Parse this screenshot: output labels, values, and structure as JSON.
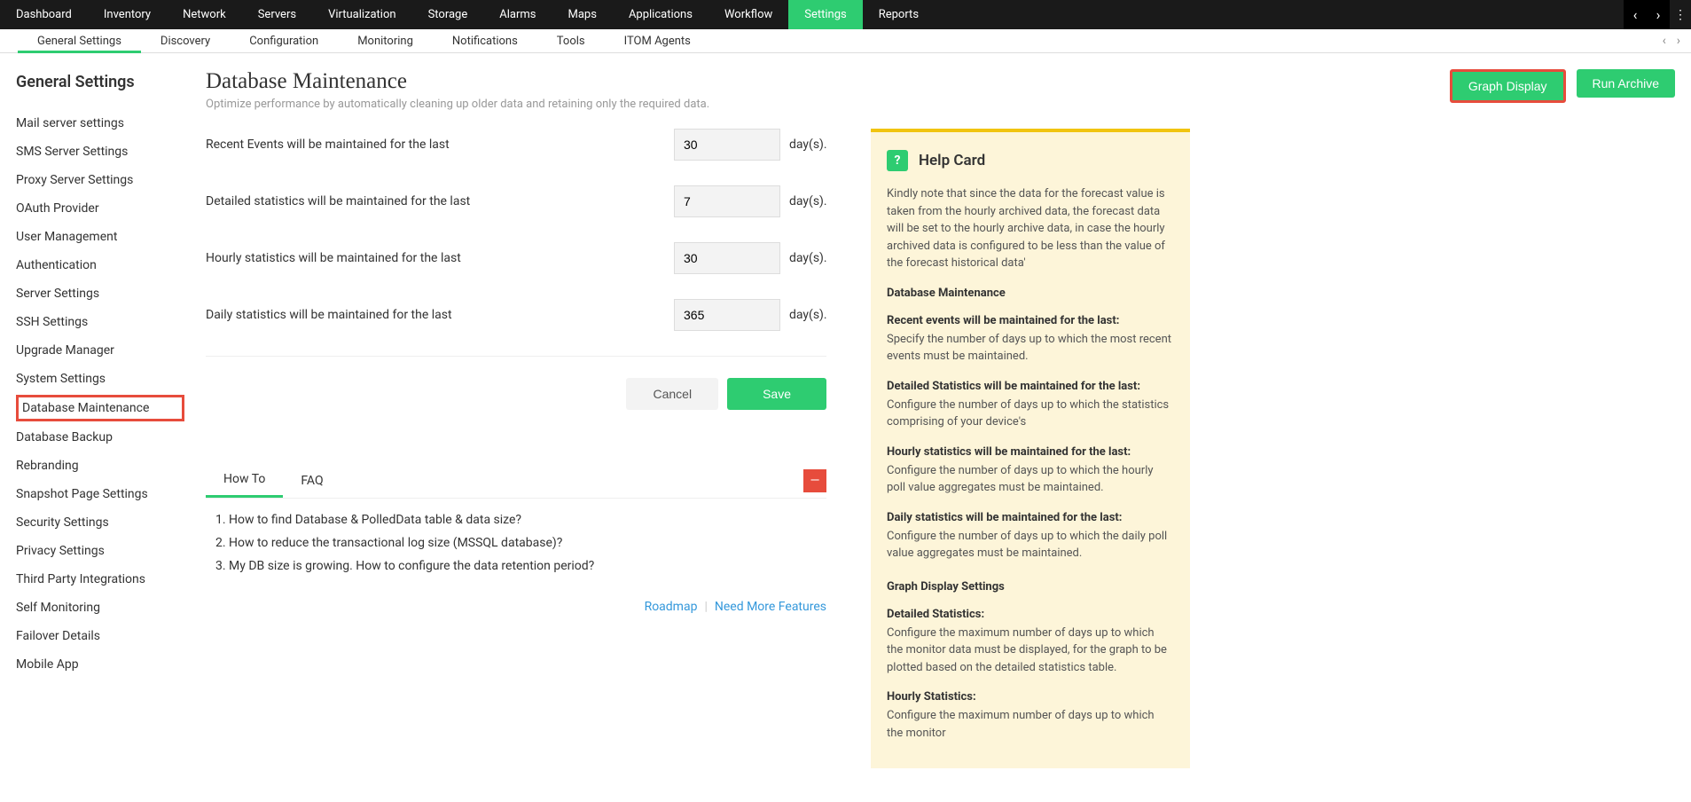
{
  "topNav": {
    "items": [
      "Dashboard",
      "Inventory",
      "Network",
      "Servers",
      "Virtualization",
      "Storage",
      "Alarms",
      "Maps",
      "Applications",
      "Workflow",
      "Settings",
      "Reports"
    ],
    "activeIndex": 10
  },
  "subNav": {
    "items": [
      "General Settings",
      "Discovery",
      "Configuration",
      "Monitoring",
      "Notifications",
      "Tools",
      "ITOM Agents"
    ],
    "activeIndex": 0
  },
  "sidebar": {
    "title": "General Settings",
    "items": [
      "Mail server settings",
      "SMS Server Settings",
      "Proxy Server Settings",
      "OAuth Provider",
      "User Management",
      "Authentication",
      "Server Settings",
      "SSH Settings",
      "Upgrade Manager",
      "System Settings",
      "Database Maintenance",
      "Database Backup",
      "Rebranding",
      "Snapshot Page Settings",
      "Security Settings",
      "Privacy Settings",
      "Third Party Integrations",
      "Self Monitoring",
      "Failover Details",
      "Mobile App"
    ],
    "activeIndex": 10
  },
  "page": {
    "title": "Database Maintenance",
    "subtitle": "Optimize performance by automatically cleaning up older data and retaining only the required data.",
    "graphDisplay": "Graph Display",
    "runArchive": "Run Archive"
  },
  "form": {
    "rows": [
      {
        "label": "Recent Events will be maintained for the last",
        "value": "30",
        "unit": "day(s)."
      },
      {
        "label": "Detailed statistics will be maintained for the last",
        "value": "7",
        "unit": "day(s)."
      },
      {
        "label": "Hourly statistics will be maintained for the last",
        "value": "30",
        "unit": "day(s)."
      },
      {
        "label": "Daily statistics will be maintained for the last",
        "value": "365",
        "unit": "day(s)."
      }
    ],
    "cancel": "Cancel",
    "save": "Save"
  },
  "tabs": {
    "items": [
      "How To",
      "FAQ"
    ],
    "activeIndex": 0
  },
  "howto": [
    "How to find Database & PolledData table & data size?",
    "How to reduce the transactional log size (MSSQL database)?",
    "My DB size is growing. How to configure the data retention period?"
  ],
  "bottomLinks": {
    "roadmap": "Roadmap",
    "needMore": "Need More Features"
  },
  "help": {
    "title": "Help Card",
    "intro": "Kindly note that since the data for the forecast value is taken from the hourly archived data, the forecast data will be set to the hourly archive data, in case the hourly archived data is configured to be less than the value of the forecast historical data'",
    "sectionTitle": "Database Maintenance",
    "items": [
      {
        "h": "Recent events will be maintained for the last:",
        "p": "Specify the number of days up to which the most recent events must be maintained."
      },
      {
        "h": "Detailed Statistics will be maintained for the last:",
        "p": "Configure the number of days up to which the statistics comprising of your device's"
      },
      {
        "h": "Hourly statistics will be maintained for the last:",
        "p": "Configure the number of days up to which the hourly poll value aggregates must be maintained."
      },
      {
        "h": "Daily statistics will be maintained for the last:",
        "p": "Configure the number of days up to which the daily poll value aggregates must be maintained."
      }
    ],
    "graphTitle": "Graph Display Settings",
    "graphItems": [
      {
        "h": "Detailed Statistics:",
        "p": "Configure the maximum number of days up to which the monitor data must be displayed, for the graph to be plotted based on the detailed statistics table."
      },
      {
        "h": "Hourly Statistics:",
        "p": "Configure the maximum number of days up to which the monitor"
      }
    ]
  }
}
